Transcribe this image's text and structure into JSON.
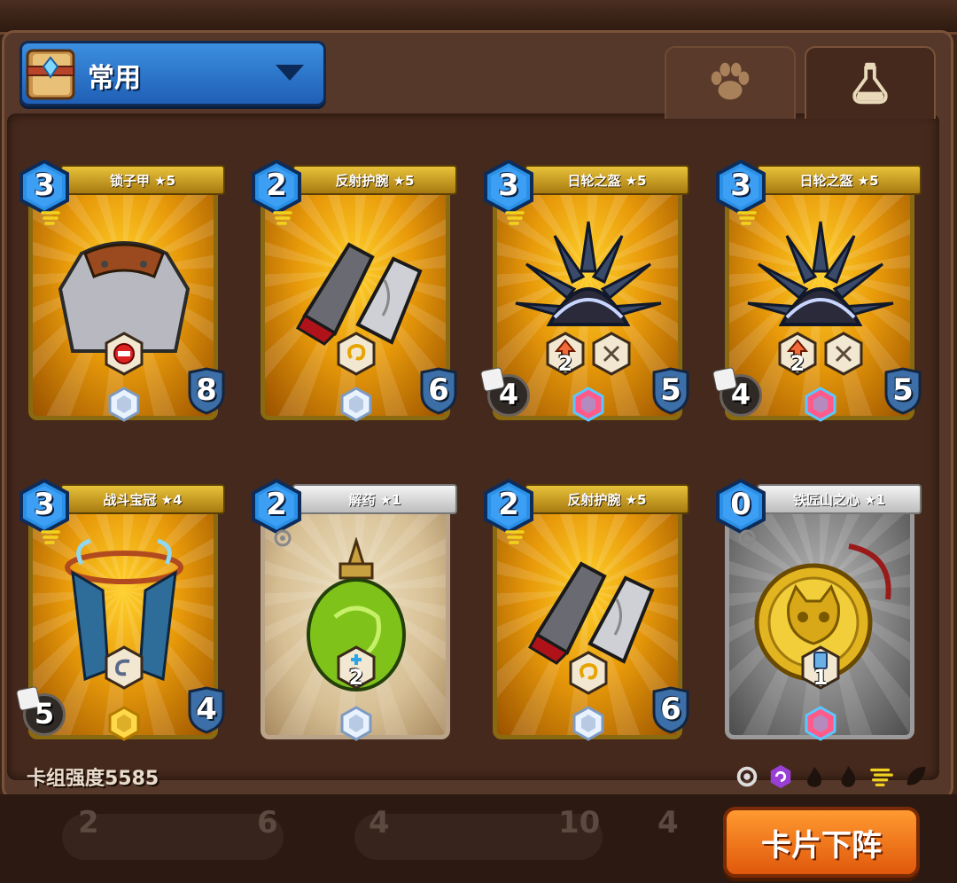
{
  "deck": {
    "name": "常用",
    "icon": "spellbook-icon"
  },
  "tabs": [
    {
      "name": "paw-icon",
      "active": false
    },
    {
      "name": "potion-icon",
      "active": true
    }
  ],
  "cards": [
    {
      "title": "锁子甲 ★5",
      "cost": "3",
      "frame": "gold",
      "art": "chainmail-armor",
      "badges": [
        {
          "icon": "no-entry-icon",
          "value": ""
        }
      ],
      "gem": "diamond",
      "shield": "8",
      "dice": ""
    },
    {
      "title": "反射护腕 ★5",
      "cost": "2",
      "frame": "gold",
      "art": "bracers",
      "badges": [
        {
          "icon": "spiral-icon",
          "value": ""
        }
      ],
      "gem": "diamond",
      "shield": "6",
      "dice": ""
    },
    {
      "title": "日轮之盔 ★5",
      "cost": "3",
      "frame": "gold",
      "art": "spiked-helmet",
      "badges": [
        {
          "icon": "upgrade-arrow-icon",
          "value": "2"
        },
        {
          "icon": "cross-icon",
          "value": ""
        }
      ],
      "gem": "rainbow",
      "shield": "5",
      "dice": "4"
    },
    {
      "title": "日轮之盔 ★5",
      "cost": "3",
      "frame": "gold",
      "art": "spiked-helmet",
      "badges": [
        {
          "icon": "upgrade-arrow-icon",
          "value": "2"
        },
        {
          "icon": "cross-icon",
          "value": ""
        }
      ],
      "gem": "rainbow",
      "shield": "5",
      "dice": "4"
    },
    {
      "title": "战斗宝冠 ★4",
      "cost": "3",
      "frame": "gold",
      "art": "battle-crown",
      "badges": [
        {
          "icon": "swirl-icon",
          "value": ""
        }
      ],
      "gem": "gold",
      "shield": "4",
      "dice": "5"
    },
    {
      "title": "解药 ★1",
      "cost": "2",
      "frame": "white",
      "art": "antidote-potion",
      "badges": [
        {
          "icon": "plus-icon",
          "value": "2"
        }
      ],
      "gem": "diamond",
      "shield": "",
      "dice": ""
    },
    {
      "title": "反射护腕 ★5",
      "cost": "2",
      "frame": "gold",
      "art": "bracers",
      "badges": [
        {
          "icon": "spiral-icon",
          "value": ""
        }
      ],
      "gem": "diamond",
      "shield": "6",
      "dice": ""
    },
    {
      "title": "铁匠山之心 ★1",
      "cost": "0",
      "frame": "silver",
      "art": "gold-cat-coin",
      "badges": [
        {
          "icon": "card-icon",
          "value": "1"
        }
      ],
      "gem": "rainbow",
      "shield": "",
      "dice": ""
    }
  ],
  "deck_strength": "卡组强度5585",
  "filters": [
    "circle-filter-icon",
    "purple-swirl-filter-icon",
    "flame-filter-icon",
    "fire-filter-icon",
    "wind-filter-icon",
    "leaf-filter-icon"
  ],
  "bottom_numbers": [
    "2",
    "6",
    "4",
    "10",
    "4"
  ],
  "remove_button": "卡片下阵",
  "colors": {
    "card_gold": "#e89a0a",
    "button_orange": "#e0580c",
    "deck_blue": "#2f7bd6"
  }
}
